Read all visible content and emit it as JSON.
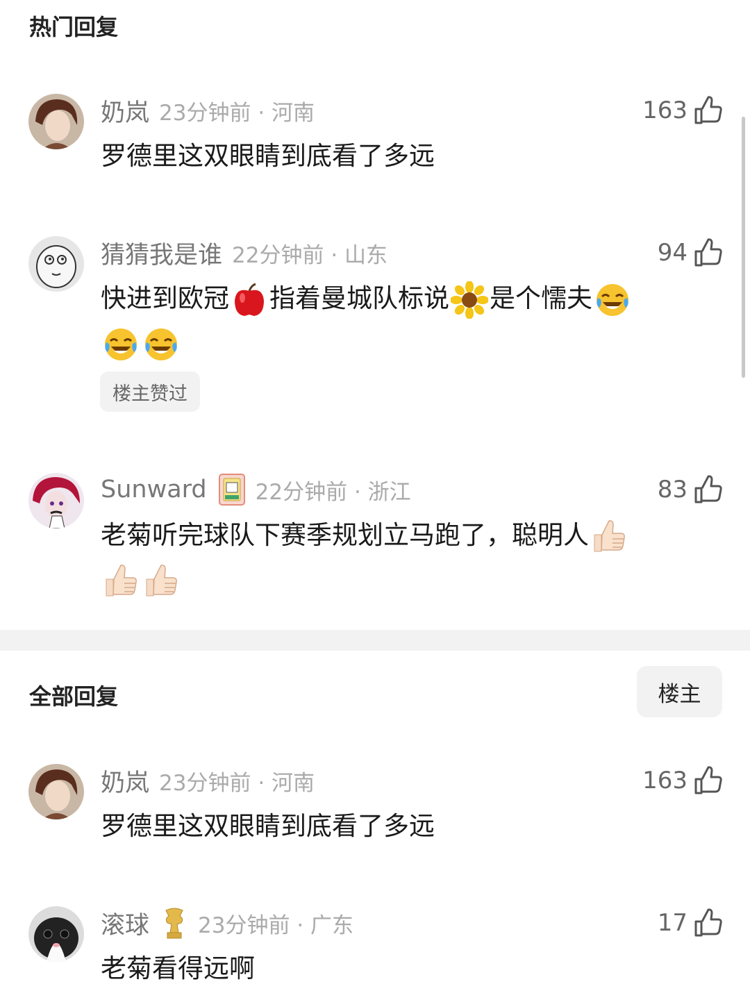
{
  "hot": {
    "title": "热门回复",
    "comments": [
      {
        "username": "奶岚",
        "time": "23分钟前 · 河南",
        "likes": "163",
        "text": "罗德里这双眼睛到底看了多远"
      },
      {
        "username": "猜猜我是谁",
        "time": "22分钟前 · 山东",
        "likes": "94",
        "text_parts": [
          "快进到欧冠",
          "指着曼城队标说",
          "是个懦夫"
        ],
        "tag": "楼主赞过"
      },
      {
        "username": "Sunward",
        "time": "22分钟前 · 浙江",
        "likes": "83",
        "text": "老菊听完球队下赛季规划立马跑了，聪明人"
      }
    ]
  },
  "all": {
    "title": "全部回复",
    "filter_label": "楼主",
    "comments": [
      {
        "username": "奶岚",
        "time": "23分钟前 · 河南",
        "likes": "163",
        "text": "罗德里这双眼睛到底看了多远"
      },
      {
        "username": "滚球",
        "time": "23分钟前 · 广东",
        "likes": "17",
        "text": "老菊看得远啊"
      }
    ]
  },
  "colors": {
    "divider": "#f2f2f2",
    "meta": "#aaaaaa",
    "username": "#777777"
  }
}
